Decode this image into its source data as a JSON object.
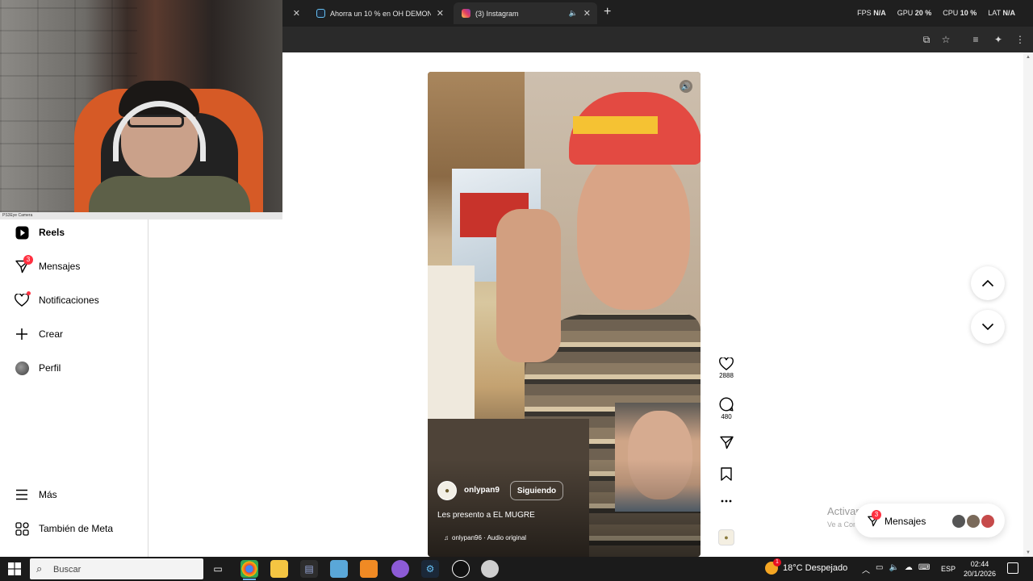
{
  "browser": {
    "tabs": [
      {
        "title": "",
        "close_label": "✕"
      },
      {
        "title": "Ahorra un 10 % en OH DEMON",
        "close_label": "✕"
      },
      {
        "title": "(3) Instagram",
        "close_label": "✕"
      }
    ],
    "new_tab_label": "+",
    "perf": [
      {
        "label": "FPS",
        "value": "N/A"
      },
      {
        "label": "GPU",
        "value": "20 %"
      },
      {
        "label": "CPU",
        "value": "10 %"
      },
      {
        "label": "LAT",
        "value": "N/A"
      }
    ]
  },
  "webcam": {
    "caption": "PS3Eye Camera"
  },
  "sidebar": {
    "items": [
      {
        "label": "Reels",
        "icon": "reels-icon",
        "active": true
      },
      {
        "label": "Mensajes",
        "icon": "messenger-icon",
        "badge": "3"
      },
      {
        "label": "Notificaciones",
        "icon": "heart-icon",
        "dot": true
      },
      {
        "label": "Crear",
        "icon": "plus-icon"
      },
      {
        "label": "Perfil",
        "icon": "avatar"
      }
    ],
    "more_label": "Más",
    "meta_label": "También de Meta"
  },
  "reel": {
    "author": "onlypan9",
    "follow_label": "Siguiendo",
    "caption": "Les presento a EL MUGRE",
    "audio": "onlypan96 · Audio original",
    "likes": "2888",
    "comments": "480"
  },
  "overlay": {
    "activate_title": "Activar Windows",
    "activate_sub": "Ve a Configuración para activar"
  },
  "messages_pill": {
    "label": "Mensajes",
    "badge": "3"
  },
  "taskbar": {
    "search_placeholder": "Buscar",
    "weather": "18°C  Despejado",
    "weather_badge": "1",
    "lang": "ESP",
    "time": "02:44",
    "date": "20/1/2026"
  },
  "colors": {
    "instagram_red": "#ff3040",
    "taskbar_bg": "#1b1b1b",
    "browser_bg": "#1f1f1f"
  }
}
